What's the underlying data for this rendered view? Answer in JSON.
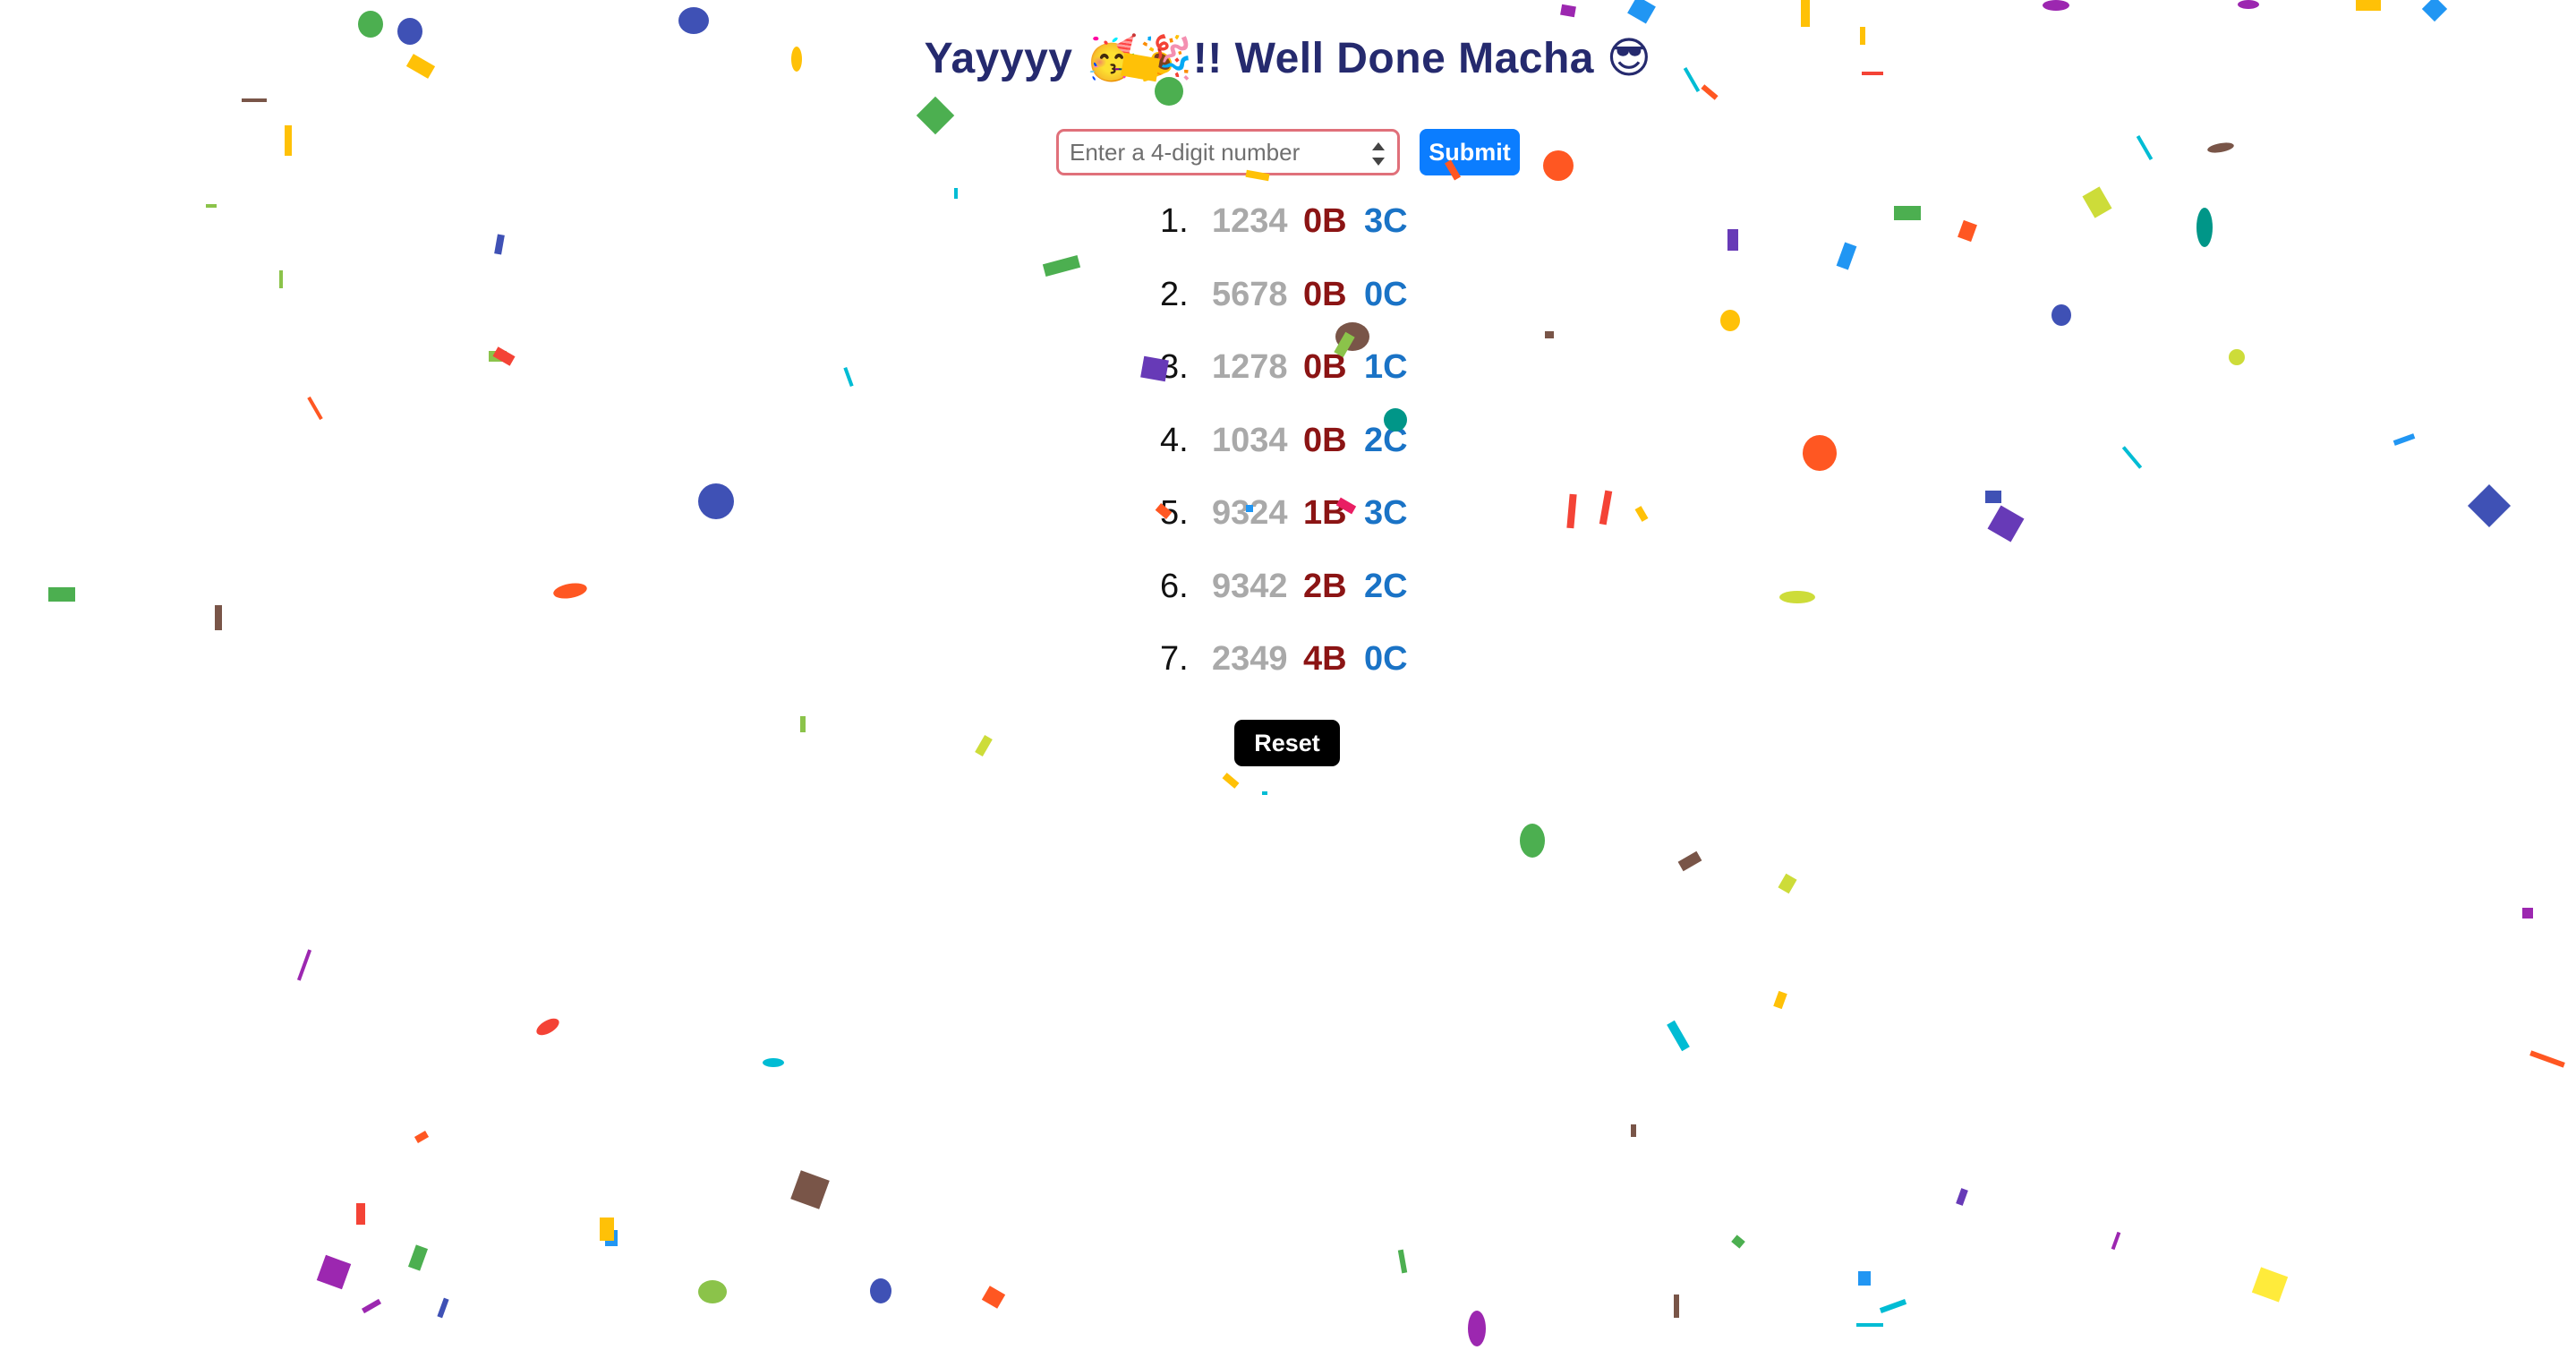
{
  "header": {
    "title": "Yayyyy 🥳🎉!! Well Done Macha 😎"
  },
  "guess_form": {
    "input_value": "",
    "input_placeholder": "Enter a 4-digit number",
    "submit_label": "Submit"
  },
  "guesses": [
    {
      "index": "1.",
      "number": "1234",
      "bulls": "0B",
      "cows": "3C"
    },
    {
      "index": "2.",
      "number": "5678",
      "bulls": "0B",
      "cows": "0C"
    },
    {
      "index": "3.",
      "number": "1278",
      "bulls": "0B",
      "cows": "1C"
    },
    {
      "index": "4.",
      "number": "1034",
      "bulls": "0B",
      "cows": "2C"
    },
    {
      "index": "5.",
      "number": "9324",
      "bulls": "1B",
      "cows": "3C"
    },
    {
      "index": "6.",
      "number": "9342",
      "bulls": "2B",
      "cows": "2C"
    },
    {
      "index": "7.",
      "number": "2349",
      "bulls": "4B",
      "cows": "0C"
    }
  ],
  "reset_label": "Reset",
  "colors": {
    "title": "#252a6e",
    "guess_number": "#a9a9a9",
    "bulls": "#8b1414",
    "cows": "#1a73c6",
    "submit_button": "#0b7dff",
    "reset_button": "#000000",
    "input_border": "#e0707a"
  },
  "confetti_palette": [
    "#4caf50",
    "#3f51b5",
    "#ffc107",
    "#f44336",
    "#ff5722",
    "#9c27b0",
    "#00bcd4",
    "#8bc34a",
    "#cddc39",
    "#795548",
    "#673ab7",
    "#2196f3",
    "#ffeb3b",
    "#009688",
    "#e91e63",
    "#03a9f4"
  ]
}
